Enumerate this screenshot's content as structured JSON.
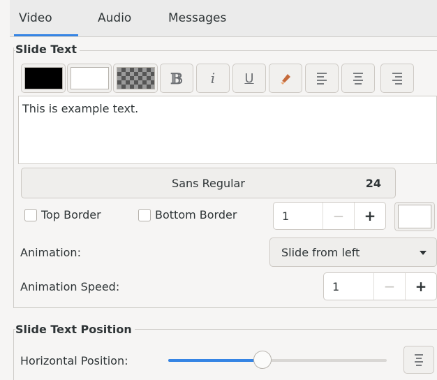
{
  "tabs": [
    {
      "label": "Video",
      "active": true
    },
    {
      "label": "Audio",
      "active": false
    },
    {
      "label": "Messages",
      "active": false
    }
  ],
  "accent_color": "#3584e4",
  "slide_text": {
    "section_label": "Slide Text",
    "toolbar": [
      {
        "icon": "text-color-swatch",
        "color": "#000000"
      },
      {
        "icon": "background-color-swatch",
        "color": "#ffffff"
      },
      {
        "icon": "transparent-checker-swatch"
      },
      {
        "icon": "bold-icon",
        "glyph": "B"
      },
      {
        "icon": "italic-icon",
        "glyph": "i"
      },
      {
        "icon": "underline-icon",
        "glyph": "U"
      },
      {
        "icon": "clear-formatting-icon"
      },
      {
        "icon": "align-left-icon"
      },
      {
        "icon": "align-center-icon"
      },
      {
        "icon": "align-right-icon"
      }
    ],
    "text": "This is example text.",
    "font": {
      "name": "Sans Regular",
      "size": "24"
    },
    "top_border_label": "Top Border",
    "bottom_border_label": "Bottom Border",
    "border_width": "1",
    "border_color": "#ffffff",
    "animation_label": "Animation:",
    "animation_value": "Slide from left",
    "animation_speed_label": "Animation Speed:",
    "animation_speed_value": "1"
  },
  "position": {
    "section_label": "Slide Text Position",
    "horizontal_label": "Horizontal Position:",
    "horizontal_value": 0.43
  }
}
